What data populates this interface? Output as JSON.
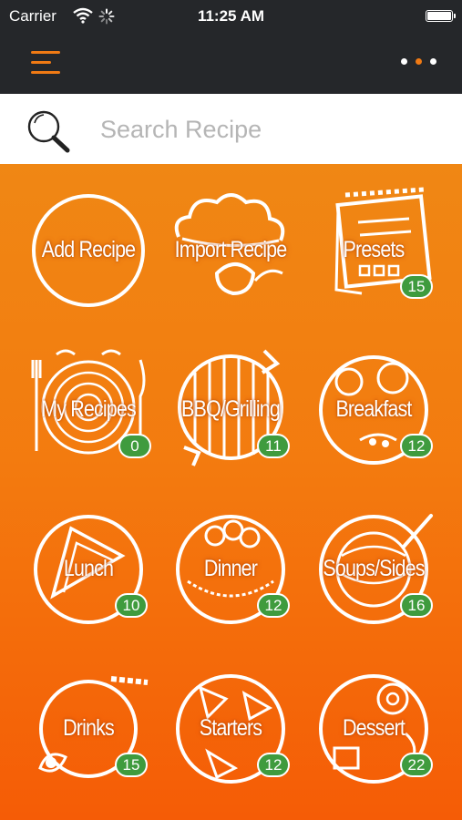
{
  "status_bar": {
    "carrier": "Carrier",
    "time": "11:25 AM"
  },
  "search": {
    "placeholder": "Search Recipe",
    "value": ""
  },
  "colors": {
    "accent": "#f07a14",
    "dark": "#25272a",
    "badge": "#3f9b3e"
  },
  "icons": {
    "menu": "hamburger-menu-icon",
    "more": "more-dots-icon",
    "search": "magnifier-icon"
  },
  "tiles": [
    {
      "label": "Add Recipe",
      "icon": "circle-plate-icon"
    },
    {
      "label": "Import Recipe",
      "icon": "chef-hat-icon"
    },
    {
      "label": "Presets",
      "icon": "notepad-icon",
      "count": "15"
    },
    {
      "label": "My Recipes",
      "icon": "plate-cutlery-icon",
      "count": "0"
    },
    {
      "label": "BBQ/Grilling",
      "icon": "grill-icon",
      "count": "11"
    },
    {
      "label": "Breakfast",
      "icon": "breakfast-plate-icon",
      "count": "12"
    },
    {
      "label": "Lunch",
      "icon": "sandwich-plate-icon",
      "count": "10"
    },
    {
      "label": "Dinner",
      "icon": "dinner-plate-icon",
      "count": "12"
    },
    {
      "label": "Soups/Sides",
      "icon": "soup-bowl-icon",
      "count": "16"
    },
    {
      "label": "Drinks",
      "icon": "drink-glass-icon",
      "count": "15"
    },
    {
      "label": "Starters",
      "icon": "starters-plate-icon",
      "count": "12"
    },
    {
      "label": "Dessert",
      "icon": "dessert-plate-icon",
      "count": "22"
    }
  ]
}
